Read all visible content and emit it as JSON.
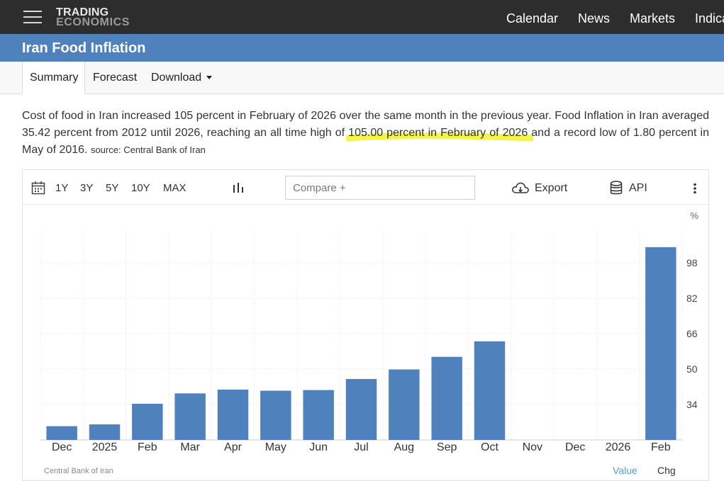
{
  "logo": {
    "line1": "TRADING",
    "line2": "ECONOMICS"
  },
  "nav": {
    "items": [
      "Calendar",
      "News",
      "Markets",
      "Indicators"
    ]
  },
  "page": {
    "title": "Iran Food Inflation"
  },
  "tabs": {
    "summary": "Summary",
    "forecast": "Forecast",
    "download": "Download"
  },
  "description": {
    "text": "Cost of food in Iran increased 105 percent in February of 2026 over the same month in the previous year. Food Inflation in Iran averaged 35.42 percent from 2012 until 2026, reaching an all time high of 105.00 percent in February of 2026 and a record low of 1.80 percent in May of 2016.",
    "source": "source: Central Bank of Iran"
  },
  "toolbar": {
    "ranges": [
      "1Y",
      "3Y",
      "5Y",
      "10Y",
      "MAX"
    ],
    "compare_placeholder": "Compare +",
    "export": "Export",
    "api": "API"
  },
  "colors": {
    "nav_bg": "#2d2d2d",
    "title_bg": "#4f81bd",
    "bar": "#4f81bd",
    "highlight": "#f2f22a"
  },
  "chart_data": {
    "type": "bar",
    "unit": "%",
    "categories": [
      "Dec",
      "2025",
      "Feb",
      "Mar",
      "Apr",
      "May",
      "Jun",
      "Jul",
      "Aug",
      "Sep",
      "Oct",
      "Nov",
      "Dec",
      "2026",
      "Feb"
    ],
    "values": [
      24.2,
      25.0,
      34.3,
      39.0,
      40.7,
      40.2,
      40.5,
      45.5,
      49.8,
      55.5,
      62.5,
      null,
      null,
      null,
      105.0
    ],
    "ylim": [
      18,
      112
    ],
    "yticks": [
      34,
      50,
      66,
      82,
      98
    ],
    "grid": true
  },
  "footer": {
    "source": "Central Bank of Iran",
    "value": "Value",
    "chg": "Chg"
  }
}
